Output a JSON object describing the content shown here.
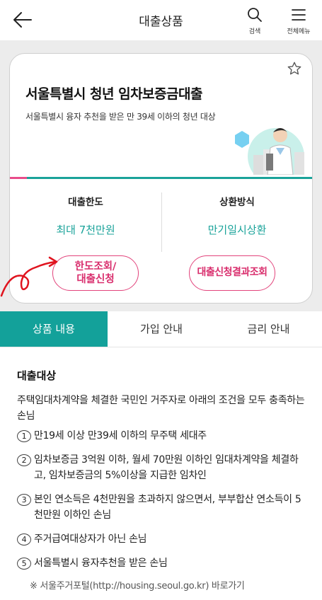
{
  "header": {
    "title": "대출상품",
    "search_label": "검색",
    "menu_label": "전체메뉴"
  },
  "card": {
    "title": "서울특별시 청년 임차보증금대출",
    "subtitle": "서울특별시 융자 추천을 받은 만 39세 이하의 청년 대상",
    "limit_label": "대출한도",
    "limit_value": "최대 7천만원",
    "repay_label": "상환방식",
    "repay_value": "만기일시상환",
    "btn_limit_line1": "한도조회/",
    "btn_limit_line2": "대출신청",
    "btn_result": "대출신청결과조회"
  },
  "tabs": [
    {
      "label": "상품 내용",
      "active": true
    },
    {
      "label": "가입 안내",
      "active": false
    },
    {
      "label": "금리 안내",
      "active": false
    }
  ],
  "content": {
    "section_title": "대출대상",
    "intro": "주택임대차계약을 체결한 국민인 거주자로 아래의 조건을 모두 충족하는 손님",
    "items": [
      {
        "num": "1",
        "text": "만19세 이상 만39세 이하의 무주택 세대주"
      },
      {
        "num": "2",
        "text": "임차보증금 3억원 이하, 월세 70만원 이하인 임대차계약을 체결하고, 임차보증금의 5%이상을 지급한 임차인"
      },
      {
        "num": "3",
        "text": "본인 연소득은 4천만원을 초과하지 않으면서, 부부합산 연소득이 5천만원 이하인 손님"
      },
      {
        "num": "4",
        "text": "주거급여대상자가 아닌 손님"
      },
      {
        "num": "5",
        "text": "서울특별시 융자추천을 받은 손님"
      }
    ],
    "note": "※ 서울주거포털(http://housing.seoul.go.kr) 바로가기"
  },
  "colors": {
    "accent_teal": "#13a19a",
    "accent_pink": "#e2447c"
  }
}
